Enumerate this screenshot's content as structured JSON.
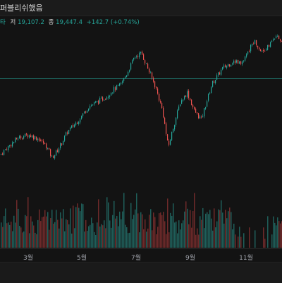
{
  "header": {
    "publisher_text": "퍼블리쉬했음"
  },
  "legend": {
    "indicator_text": "타",
    "low_label": "저",
    "low_value": "19,107.2",
    "close_label": "종",
    "close_value": "19,447.4",
    "change_text": "+142.7 (+0.74%)"
  },
  "colors": {
    "up": "#26a69a",
    "down": "#ef5350",
    "up_volume": "#1f5e59",
    "down_volume": "#6e2a2a",
    "guide_line": "#26a69a"
  },
  "chart_data": {
    "type": "candlestick",
    "x_ticks": [
      "3월",
      "5월",
      "7월",
      "9월",
      "11월"
    ],
    "guide_value": 19340,
    "price_range": [
      16000,
      21000
    ],
    "anchors": [
      {
        "t": 0,
        "p": 16650
      },
      {
        "t": 10,
        "p": 16900
      },
      {
        "t": 25,
        "p": 17250
      },
      {
        "t": 40,
        "p": 17350
      },
      {
        "t": 55,
        "p": 17200
      },
      {
        "t": 65,
        "p": 16950
      },
      {
        "t": 73,
        "p": 16550
      },
      {
        "t": 80,
        "p": 16750
      },
      {
        "t": 95,
        "p": 17450
      },
      {
        "t": 110,
        "p": 17850
      },
      {
        "t": 125,
        "p": 18350
      },
      {
        "t": 140,
        "p": 18550
      },
      {
        "t": 150,
        "p": 18700
      },
      {
        "t": 160,
        "p": 18950
      },
      {
        "t": 170,
        "p": 19100
      },
      {
        "t": 180,
        "p": 19550
      },
      {
        "t": 190,
        "p": 20100
      },
      {
        "t": 200,
        "p": 20250
      },
      {
        "t": 210,
        "p": 19650
      },
      {
        "t": 220,
        "p": 19050
      },
      {
        "t": 230,
        "p": 18200
      },
      {
        "t": 238,
        "p": 16900
      },
      {
        "t": 245,
        "p": 17600
      },
      {
        "t": 255,
        "p": 18500
      },
      {
        "t": 265,
        "p": 18850
      },
      {
        "t": 275,
        "p": 18200
      },
      {
        "t": 285,
        "p": 17900
      },
      {
        "t": 300,
        "p": 19150
      },
      {
        "t": 315,
        "p": 19700
      },
      {
        "t": 330,
        "p": 19950
      },
      {
        "t": 345,
        "p": 19950
      },
      {
        "t": 360,
        "p": 20700
      },
      {
        "t": 370,
        "p": 20300
      },
      {
        "t": 380,
        "p": 20500
      },
      {
        "t": 390,
        "p": 20800
      },
      {
        "t": 399,
        "p": 20700
      }
    ]
  }
}
